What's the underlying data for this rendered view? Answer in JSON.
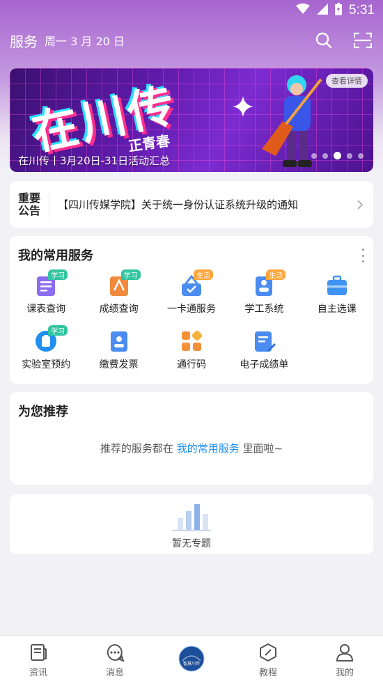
{
  "status_bar": {
    "time": "5:31"
  },
  "header": {
    "title": "服务",
    "date": "周一 3 月 20 日"
  },
  "banner": {
    "big_text": "在川传",
    "sub_text": "正青春",
    "detail_button": "查看详情",
    "caption": "在川传丨3月20日-31日活动汇总",
    "slide_count": 5,
    "active_slide": 3
  },
  "notice": {
    "tag_line1": "重要",
    "tag_line2": "公告",
    "text": "【四川传媒学院】关于统一身份认证系统升级的通知"
  },
  "services": {
    "title": "我的常用服务",
    "items": [
      {
        "label": "课表查询",
        "badge": "学习",
        "badge_type": "study",
        "icon": "schedule-icon",
        "color": "#8b6cf0"
      },
      {
        "label": "成绩查询",
        "badge": "学习",
        "badge_type": "study",
        "icon": "grade-icon",
        "color": "#f08a3c"
      },
      {
        "label": "一卡通服务",
        "badge": "生活",
        "badge_type": "life",
        "icon": "card-icon",
        "color": "#4a8cf0"
      },
      {
        "label": "学工系统",
        "badge": "生活",
        "badge_type": "life",
        "icon": "student-affairs-icon",
        "color": "#4a8cf0"
      },
      {
        "label": "自主选课",
        "badge": "",
        "badge_type": "",
        "icon": "course-select-icon",
        "color": "#3f93f2"
      },
      {
        "label": "实验室预约",
        "badge": "学习",
        "badge_type": "study",
        "icon": "lab-booking-icon",
        "color": "#1f8ff0"
      },
      {
        "label": "缴费发票",
        "badge": "",
        "badge_type": "",
        "icon": "invoice-icon",
        "color": "#4a8cf0"
      },
      {
        "label": "通行码",
        "badge": "",
        "badge_type": "",
        "icon": "pass-code-icon",
        "color": "#f5903a"
      },
      {
        "label": "电子成绩单",
        "badge": "",
        "badge_type": "",
        "icon": "transcript-icon",
        "color": "#4a8cf0"
      }
    ]
  },
  "recommend": {
    "title": "为您推荐",
    "msg_prefix": "推荐的服务都在",
    "msg_link": "我的常用服务",
    "msg_suffix": "里面啦~"
  },
  "topic": {
    "empty_text": "暂无专题"
  },
  "tabbar": {
    "items": [
      {
        "label": "资讯",
        "icon": "news-icon"
      },
      {
        "label": "消息",
        "icon": "message-icon"
      },
      {
        "label": "",
        "icon": "app-logo-icon",
        "logo_text": "智慧川传"
      },
      {
        "label": "教程",
        "icon": "tutorial-icon"
      },
      {
        "label": "我的",
        "icon": "profile-icon"
      }
    ]
  }
}
